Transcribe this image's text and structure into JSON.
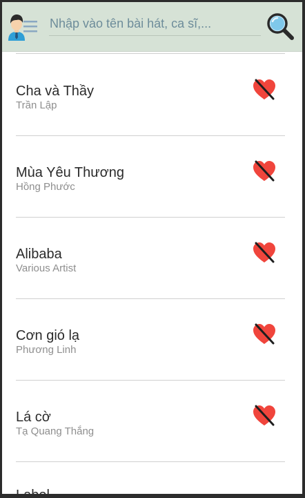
{
  "search": {
    "placeholder": "Nhập vào tên bài hát, ca sĩ,..."
  },
  "icons": {
    "menu": "avatar-menu-icon",
    "search": "magnifier-icon",
    "favorite": "heart-crossed-icon"
  },
  "colors": {
    "header_bg": "#d6e2d6",
    "heart": "#f0453c",
    "placeholder": "#6d8c9a"
  },
  "songs": [
    {
      "title": "Cha và Thầy",
      "artist": "Trần Lập"
    },
    {
      "title": "Mùa Yêu Thương",
      "artist": "Hồng Phước"
    },
    {
      "title": "Alibaba",
      "artist": "Various Artist"
    },
    {
      "title": "Cơn gió lạ",
      "artist": "Phương Linh"
    },
    {
      "title": "Lá cờ",
      "artist": "Tạ Quang Thắng"
    }
  ],
  "last_row_label": "Label"
}
